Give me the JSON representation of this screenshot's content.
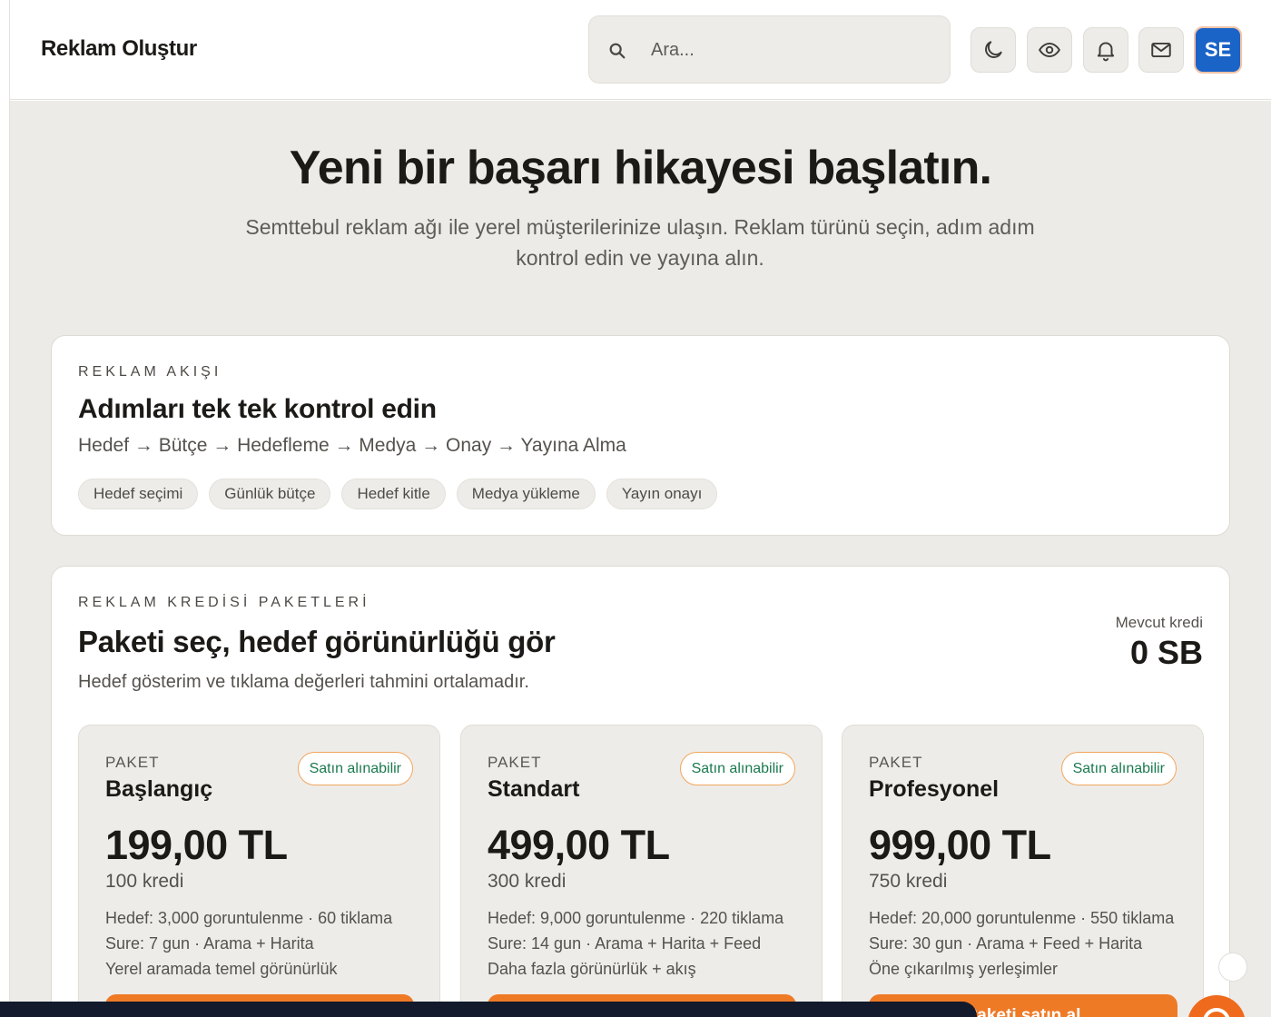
{
  "header": {
    "title": "Reklam Oluştur",
    "search_placeholder": "Ara...",
    "avatar_initials": "SE",
    "icons": [
      "moon-icon",
      "eye-icon",
      "bell-icon",
      "mail-icon"
    ]
  },
  "hero": {
    "title": "Yeni bir başarı hikayesi başlatın.",
    "subtitle": "Semttebul reklam ağı ile yerel müşterilerinize ulaşın. Reklam türünü seçin, adım adım kontrol edin ve yayına alın."
  },
  "flow": {
    "eyebrow": "REKLAM AKIŞI",
    "title": "Adımları tek tek kontrol edin",
    "steps_text": "Hedef → Bütçe → Hedefleme → Medya → Onay → Yayına Alma",
    "chips": [
      "Hedef seçimi",
      "Günlük bütçe",
      "Hedef kitle",
      "Medya yükleme",
      "Yayın onayı"
    ]
  },
  "packages": {
    "eyebrow": "REKLAM KREDİSİ PAKETLERİ",
    "title": "Paketi seç, hedef görünürlüğü gör",
    "description": "Hedef gösterim ve tıklama değerleri tahmini ortalamadır.",
    "credit_label": "Mevcut kredi",
    "credit_value": "0 SB",
    "items": [
      {
        "eyebrow": "PAKET",
        "name": "Başlangıç",
        "badge": "Satın alınabilir",
        "price": "199,00 TL",
        "credits": "100 kredi",
        "target": "Hedef: 3,000 goruntulenme · 60 tiklama",
        "duration": "Sure: 7 gun · Arama + Harita",
        "note": "Yerel aramada temel görünürlük",
        "button": ""
      },
      {
        "eyebrow": "PAKET",
        "name": "Standart",
        "badge": "Satın alınabilir",
        "price": "499,00 TL",
        "credits": "300 kredi",
        "target": "Hedef: 9,000 goruntulenme · 220 tiklama",
        "duration": "Sure: 14 gun · Arama + Harita + Feed",
        "note": "Daha fazla görünürlük + akış",
        "button": ""
      },
      {
        "eyebrow": "PAKET",
        "name": "Profesyonel",
        "badge": "Satın alınabilir",
        "price": "999,00 TL",
        "credits": "750 kredi",
        "target": "Hedef: 20,000 goruntulenme · 550 tiklama",
        "duration": "Sure: 30 gun · Arama + Feed + Harita",
        "note": "Öne çıkarılmış yerleşimler",
        "button": "Paketi satın al"
      }
    ]
  },
  "colors": {
    "accent": "#ef7a26",
    "avatar_bg": "#1a63c7",
    "badge_text": "#1b7a4f",
    "page_bg": "#edebe7"
  }
}
